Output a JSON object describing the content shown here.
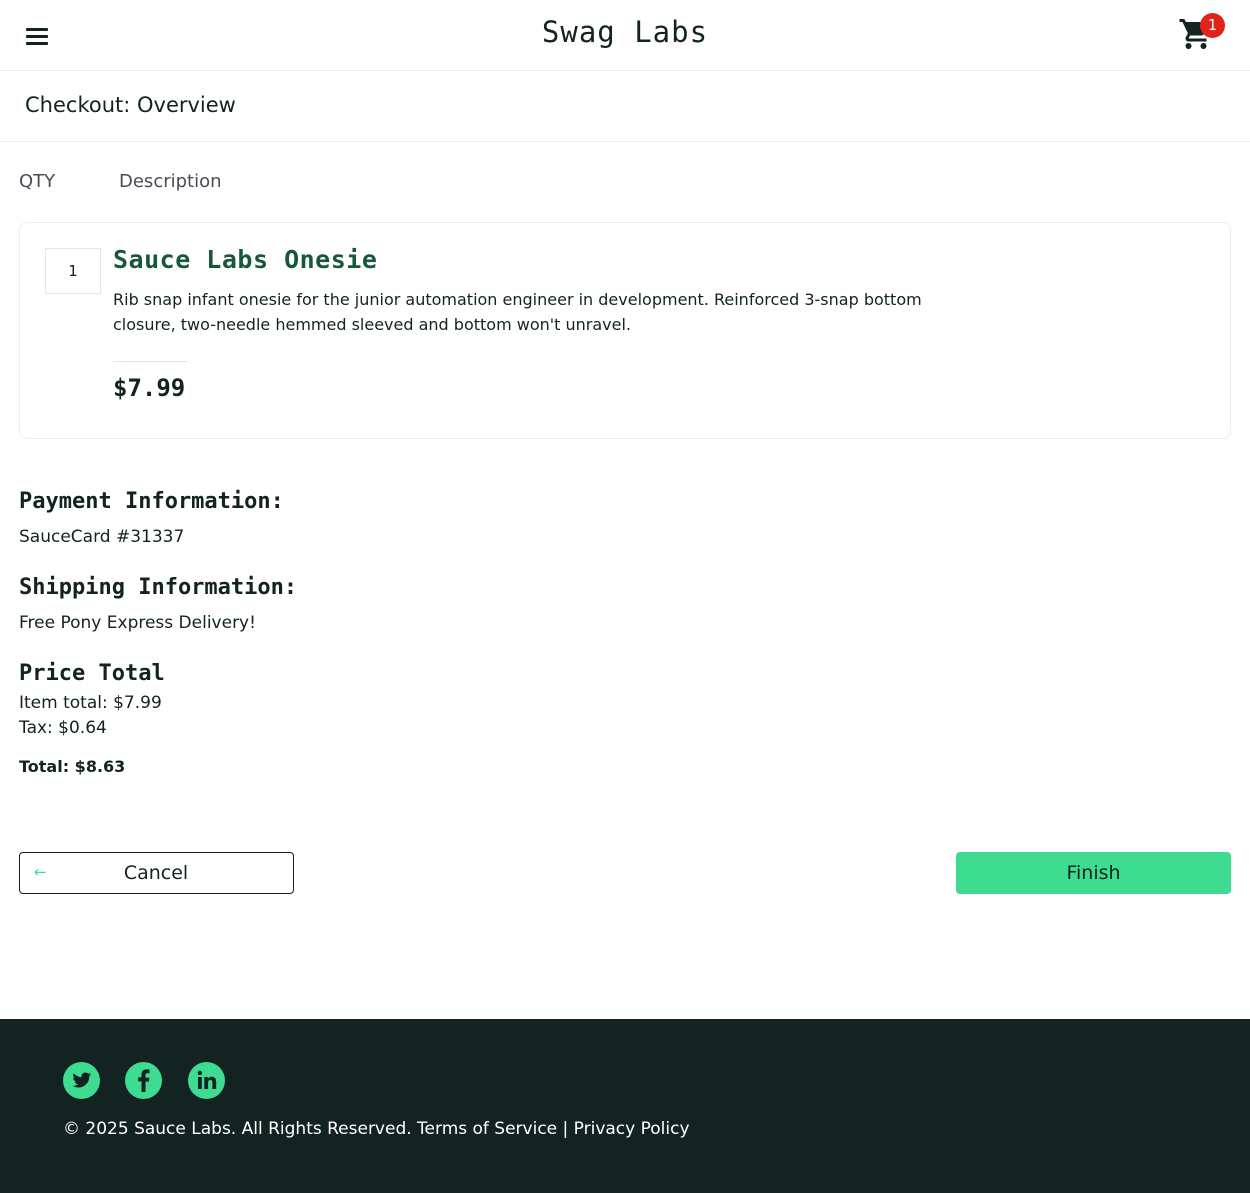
{
  "header": {
    "title": "Swag Labs",
    "cart_count": "1"
  },
  "page": {
    "title": "Checkout: Overview"
  },
  "columns": {
    "qty": "QTY",
    "description": "Description"
  },
  "items": [
    {
      "qty": "1",
      "name": "Sauce Labs Onesie",
      "description": "Rib snap infant onesie for the junior automation engineer in development. Reinforced 3-snap bottom closure, two-needle hemmed sleeved and bottom won't unravel.",
      "price": "$7.99"
    }
  ],
  "summary": {
    "payment_label": "Payment Information:",
    "payment_value": "SauceCard #31337",
    "shipping_label": "Shipping Information:",
    "shipping_value": "Free Pony Express Delivery!",
    "price_label": "Price Total",
    "item_total": "Item total: $7.99",
    "tax": "Tax: $0.64",
    "total": "Total: $8.63"
  },
  "actions": {
    "cancel": "Cancel",
    "finish": "Finish"
  },
  "footer": {
    "copyright": "© 2025 Sauce Labs. All Rights Reserved. Terms of Service | Privacy Policy",
    "social": [
      "twitter-icon",
      "facebook-icon",
      "linkedin-icon"
    ]
  },
  "colors": {
    "accent": "#3ddc91",
    "dark": "#132322",
    "item_name": "#18583a",
    "badge": "#e2231a"
  }
}
